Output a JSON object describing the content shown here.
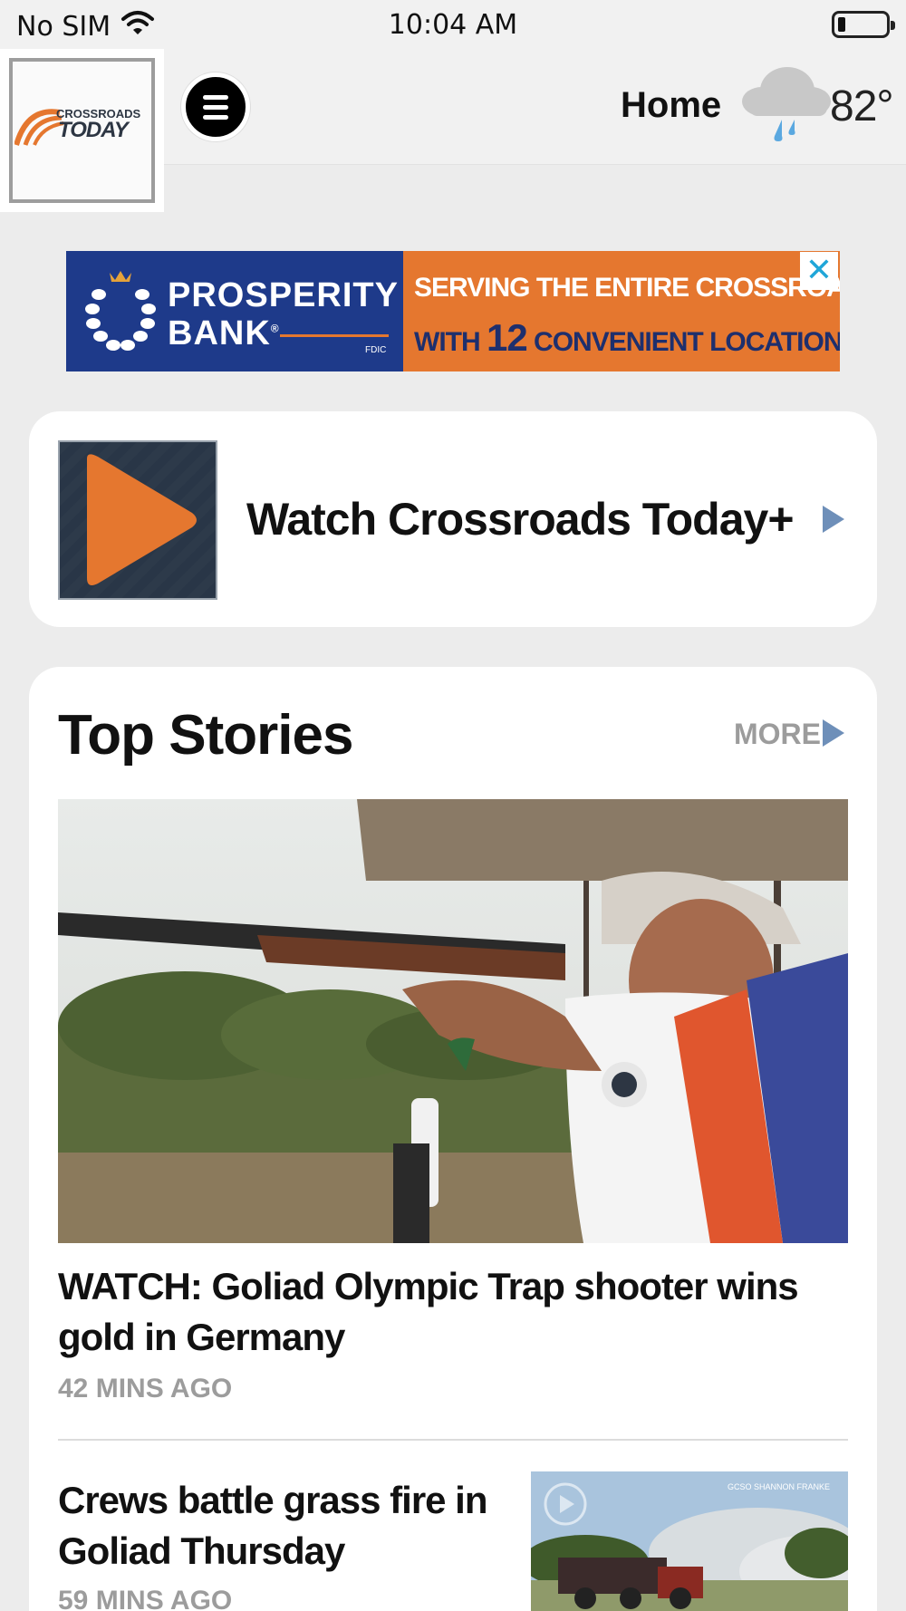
{
  "status_bar": {
    "carrier": "No SIM",
    "time": "10:04 AM",
    "wifi_icon": "wifi-icon",
    "battery_icon": "battery-icon",
    "battery_level": 0.15
  },
  "header": {
    "logo_line1": "CROSSROADS",
    "logo_line2": "TODAY",
    "menu_icon": "hamburger-menu-icon",
    "section_label": "Home",
    "weather_icon": "rain-cloud-icon",
    "temperature": "82°"
  },
  "ad": {
    "brand_line1": "PROSPERITY",
    "brand_line2": "BANK",
    "brand_registered": "®",
    "fdic": "FDIC",
    "message_line1": "SERVING THE ENTIRE CROSSROADS AREA",
    "message_line2_prefix": "WITH",
    "message_line2_number": "12",
    "message_line2_suffix": "CONVENIENT LOCATIONS",
    "close_icon": "close-icon",
    "close_label": "✕",
    "colors": {
      "left": "#1e3a8a",
      "right": "#e5772f"
    }
  },
  "watch": {
    "title": "Watch Crossroads Today+",
    "play_icon": "play-icon",
    "chevron_icon": "chevron-right-icon"
  },
  "top_stories": {
    "title": "Top Stories",
    "more_label": "MORE",
    "stories": [
      {
        "headline": "WATCH: Goliad Olympic Trap shooter wins gold in Germany",
        "time": "42 MINS AGO"
      },
      {
        "headline": "Crews battle grass fire in Goliad Thursday",
        "time": "59 MINS AGO",
        "image_credit": "GCSO SHANNON FRANKE"
      }
    ]
  },
  "colors": {
    "accent_orange": "#e5772f",
    "chevron_blue": "#6e8fb9",
    "muted_text": "#9c9c9c"
  }
}
